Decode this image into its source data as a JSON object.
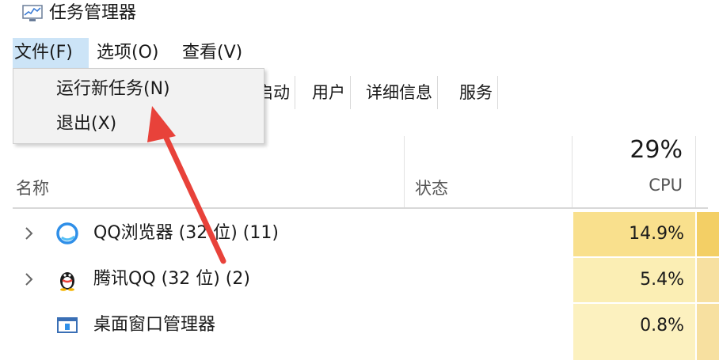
{
  "window": {
    "title": "任务管理器",
    "icon": "task-manager-icon"
  },
  "menubar": {
    "file": "文件(F)",
    "options": "选项(O)",
    "view": "查看(V)"
  },
  "file_menu": {
    "run_new_task": "运行新任务(N)",
    "exit": "退出(X)"
  },
  "tabs": {
    "startup_partial": "启动",
    "users": "用户",
    "details": "详细信息",
    "services": "服务"
  },
  "columns": {
    "name": "名称",
    "status": "状态",
    "cpu_total": "29%",
    "cpu": "CPU"
  },
  "processes": [
    {
      "name": "QQ浏览器 (32 位) (11)",
      "cpu": "14.9%",
      "icon": "qq-browser-icon",
      "expandable": true
    },
    {
      "name": "腾讯QQ (32 位) (2)",
      "cpu": "5.4%",
      "icon": "qq-penguin-icon",
      "expandable": true
    },
    {
      "name": "桌面窗口管理器",
      "cpu": "0.8%",
      "icon": "desktop-window-manager-icon",
      "expandable": false
    }
  ],
  "colors": {
    "menu_highlight": "#cce4f7",
    "cpu_high": "#f9e08d",
    "cpu_mid": "#fbeeb4",
    "arrow": "#e8423a"
  }
}
